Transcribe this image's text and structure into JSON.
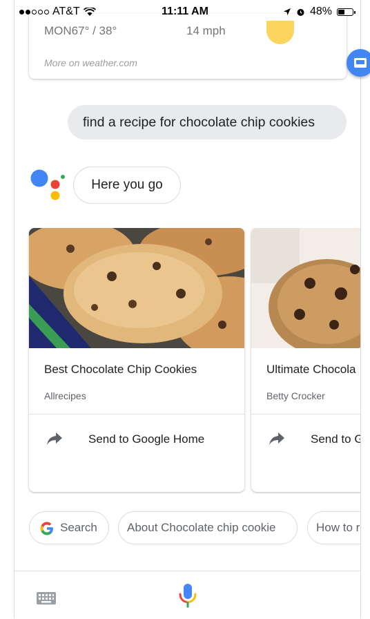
{
  "status_bar": {
    "carrier": "AT&T",
    "time": "11:11 AM",
    "battery": "48%",
    "battery_level": 0.48
  },
  "weather_card": {
    "day_temp": "MON67° / 38°",
    "wind": "14 mph",
    "source_link": "More on weather.com",
    "icons": [
      "sun-icon",
      "cast-icon"
    ],
    "colors": {
      "sun": "#fbd55d",
      "fab": "#4285f4"
    }
  },
  "conversation": {
    "user_query": "find a recipe for chocolate chip cookies",
    "assistant_reply": "Here you go"
  },
  "recipe_cards": [
    {
      "title": "Best Chocolate Chip Cookies",
      "source": "Allrecipes",
      "action": "Send to Google Home"
    },
    {
      "title": "Ultimate Chocola",
      "source": "Betty Crocker",
      "action": "Send to G"
    }
  ],
  "suggestion_chips": [
    {
      "label": "Search",
      "icon": "google-g-icon"
    },
    {
      "label": "About Chocolate chip cookie"
    },
    {
      "label": "How to r"
    }
  ],
  "bottom_bar": {
    "icons": [
      "keyboard-icon",
      "mic-icon"
    ]
  },
  "brand_colors": {
    "blue": "#4285f4",
    "red": "#ea4335",
    "yellow": "#fbbc05",
    "green": "#34a853"
  }
}
